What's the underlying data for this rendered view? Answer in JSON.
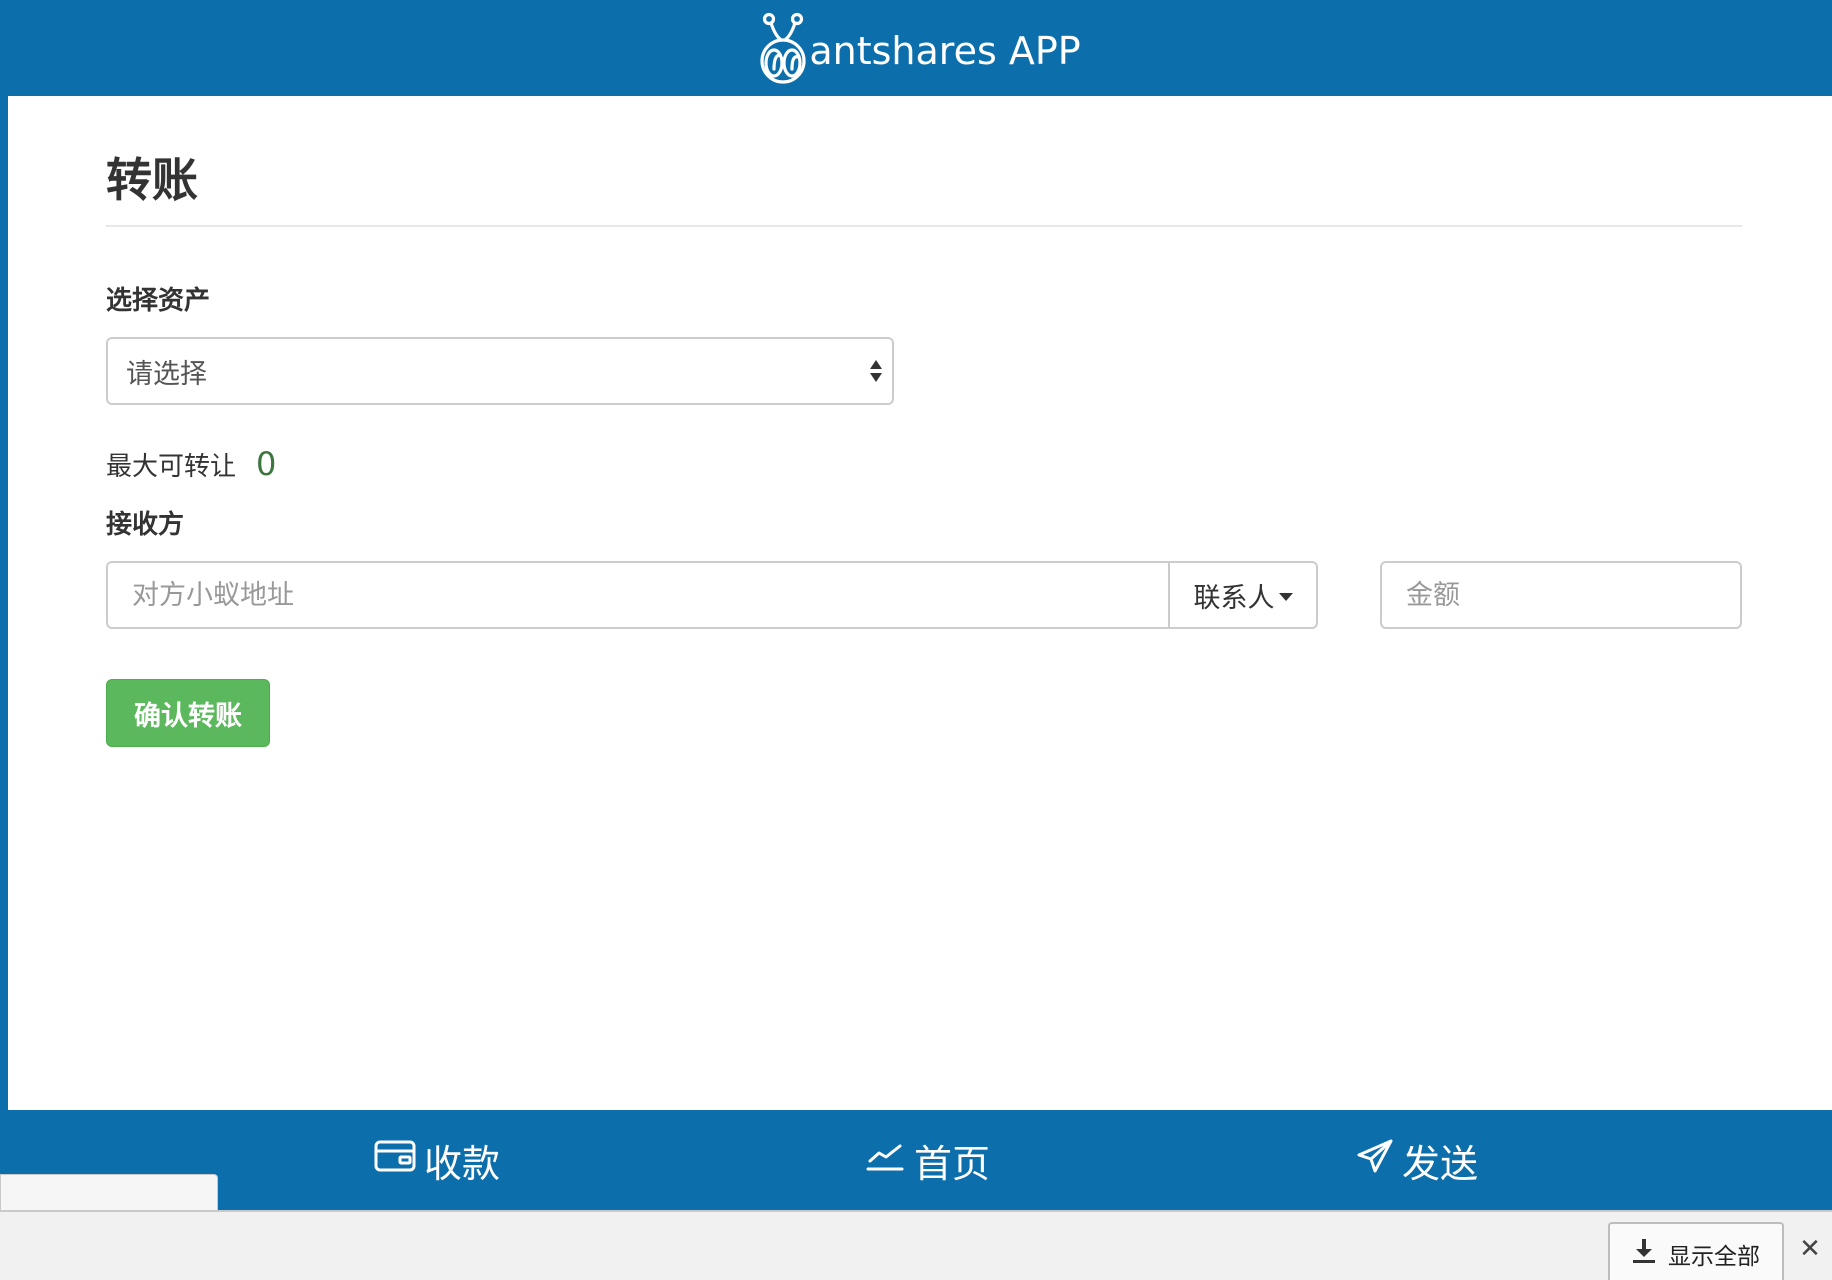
{
  "header": {
    "brand_text": "antshares APP",
    "logo_icon": "ant-logo-icon"
  },
  "page": {
    "title": "转账"
  },
  "asset": {
    "label": "选择资产",
    "selected": "请选择"
  },
  "max_transfer": {
    "label": "最大可转让",
    "value": "0"
  },
  "recipient": {
    "label": "接收方",
    "address_placeholder": "对方小蚁地址",
    "contacts_label": "联系人",
    "amount_placeholder": "金额"
  },
  "actions": {
    "confirm_label": "确认转账"
  },
  "bottom_nav": {
    "items": [
      {
        "label": "收款",
        "icon": "wallet-icon"
      },
      {
        "label": "首页",
        "icon": "chart-line-icon"
      },
      {
        "label": "发送",
        "icon": "paper-plane-icon"
      }
    ]
  },
  "download_bar": {
    "show_all_label": "显示全部",
    "close_symbol": "✕"
  },
  "colors": {
    "primary": "#0c6fac",
    "success": "#5cb85c",
    "max_value": "#3c763d"
  }
}
